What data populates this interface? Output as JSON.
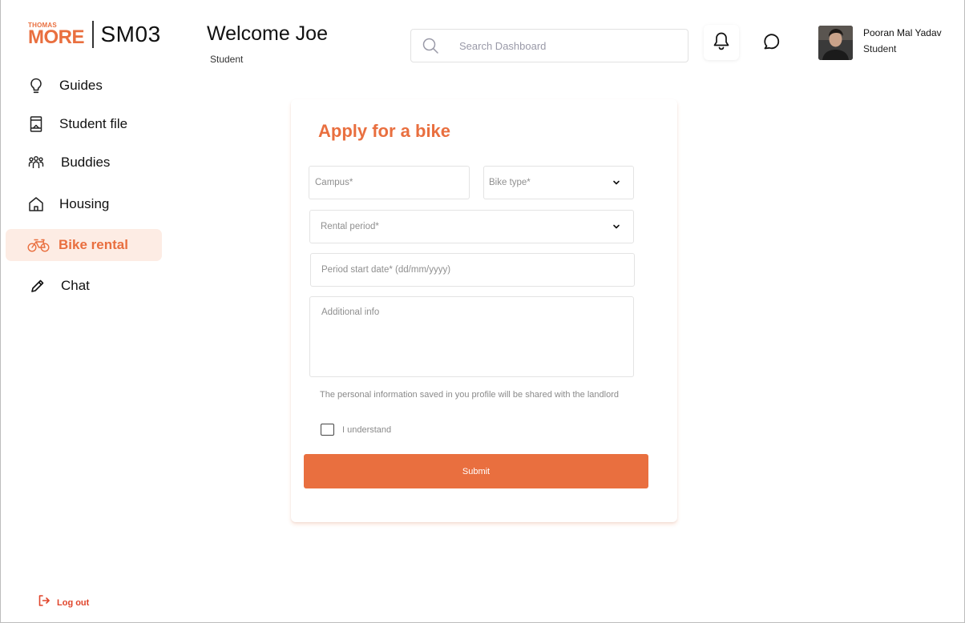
{
  "brand": {
    "logo_top": "THOMAS",
    "logo_main": "MORE",
    "code": "SM03",
    "accent": "#e96f3f"
  },
  "sidebar": {
    "items": [
      {
        "label": "Guides",
        "icon": "lightbulb-icon",
        "active": false
      },
      {
        "label": "Student file",
        "icon": "student-file-icon",
        "active": false
      },
      {
        "label": "Buddies",
        "icon": "buddies-icon",
        "active": false
      },
      {
        "label": "Housing",
        "icon": "house-icon",
        "active": false
      },
      {
        "label": "Bike rental",
        "icon": "bike-icon",
        "active": true
      },
      {
        "label": "Chat",
        "icon": "pencil-icon",
        "active": false
      }
    ],
    "logout_label": "Log out"
  },
  "header": {
    "welcome": "Welcome Joe",
    "role": "Student",
    "search_placeholder": "Search Dashboard"
  },
  "user": {
    "name": "Pooran Mal Yadav",
    "role": "Student"
  },
  "form": {
    "title": "Apply for a bike",
    "campus_placeholder": "Campus*",
    "bike_type_placeholder": "Bike type*",
    "rental_period_placeholder": "Rental period*",
    "start_date_placeholder": "Period start date* (dd/mm/yyyy)",
    "additional_info_placeholder": "Additional info",
    "notice": "The personal information saved in you profile will be shared with the landlord",
    "checkbox_label": "I understand",
    "submit_label": "Submit"
  }
}
